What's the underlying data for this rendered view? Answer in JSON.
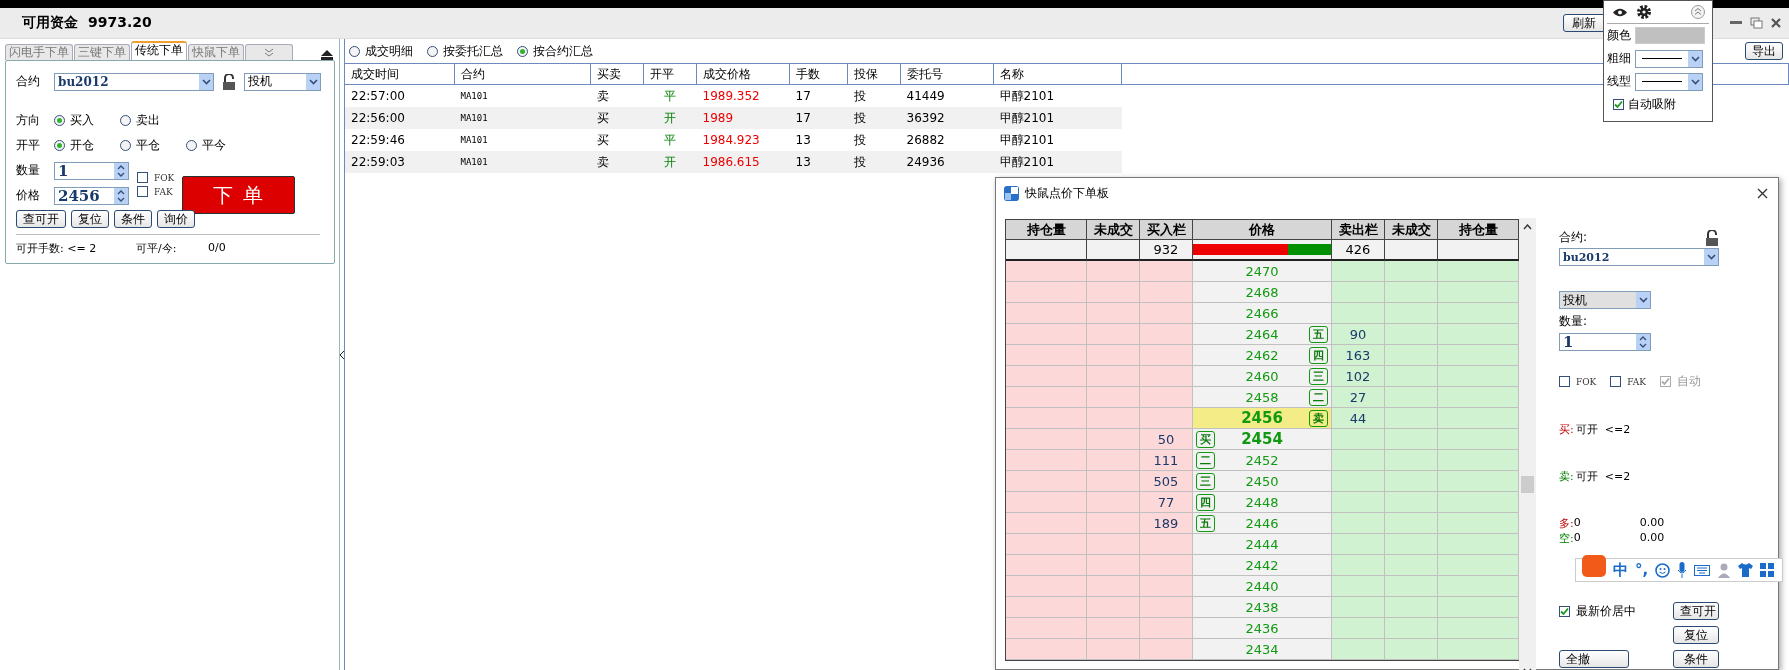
{
  "header": {
    "funds_label": "可用资金",
    "funds_value": "9973.20",
    "refresh_button": "刷新"
  },
  "order_panel": {
    "tabs": [
      {
        "label": "闪电手下单",
        "selected": false
      },
      {
        "label": "三键下单",
        "selected": false
      },
      {
        "label": "传统下单",
        "selected": true
      },
      {
        "label": "快鼠下单",
        "selected": false
      }
    ],
    "contract_label": "合约",
    "contract": "bu2012",
    "hedge": "投机",
    "direction_label": "方向",
    "direction_options": [
      {
        "label": "买入",
        "selected": true
      },
      {
        "label": "卖出",
        "selected": false
      }
    ],
    "offset_label": "开平",
    "offset_options": [
      {
        "label": "开仓",
        "selected": true
      },
      {
        "label": "平仓",
        "selected": false
      },
      {
        "label": "平今",
        "selected": false
      }
    ],
    "qty_label": "数量",
    "qty": "1",
    "price_label": "价格",
    "price": "2456",
    "flags": [
      {
        "label": "FOK",
        "checked": false
      },
      {
        "label": "FAK",
        "checked": false
      }
    ],
    "submit_button": "下 单",
    "buttons": [
      "查可开",
      "复位",
      "条件",
      "询价"
    ],
    "footer": {
      "open_label": "可开手数: <= 2",
      "close_label": "可平/今:",
      "close_value": "0/0"
    }
  },
  "trades": {
    "views": [
      {
        "label": "成交明细",
        "selected": false
      },
      {
        "label": "按委托汇总",
        "selected": false
      },
      {
        "label": "按合约汇总",
        "selected": true
      }
    ],
    "export_button": "导出",
    "columns": [
      "成交时间",
      "合约",
      "买卖",
      "开平",
      "成交价格",
      "手数",
      "投保",
      "委托号",
      "名称"
    ],
    "rows": [
      {
        "time": "22:57:00",
        "contract": "MA101",
        "side": "卖",
        "offset": "平",
        "price": "1989.352",
        "qty": "17",
        "hedge": "投",
        "order_no": "41449",
        "name": "甲醇2101"
      },
      {
        "time": "22:56:00",
        "contract": "MA101",
        "side": "买",
        "offset": "开",
        "price": "1989",
        "qty": "17",
        "hedge": "投",
        "order_no": "36392",
        "name": "甲醇2101"
      },
      {
        "time": "22:59:46",
        "contract": "MA101",
        "side": "买",
        "offset": "平",
        "price": "1984.923",
        "qty": "13",
        "hedge": "投",
        "order_no": "26882",
        "name": "甲醇2101"
      },
      {
        "time": "22:59:03",
        "contract": "MA101",
        "side": "卖",
        "offset": "开",
        "price": "1986.615",
        "qty": "13",
        "hedge": "投",
        "order_no": "24936",
        "name": "甲醇2101"
      }
    ]
  },
  "chart_tool": {
    "color_label": "颜色",
    "width_label": "粗细",
    "style_label": "线型",
    "snap": {
      "label": "自动吸附",
      "checked": true
    }
  },
  "ladder_window": {
    "title": "快鼠点价下单板",
    "columns": [
      "持仓量",
      "未成交",
      "买入栏",
      "价格",
      "卖出栏",
      "未成交",
      "持仓量"
    ],
    "totals": {
      "buy": "932",
      "sell": "426",
      "level": 0.686
    },
    "rows": [
      {
        "price": "2470",
        "kind": "plain"
      },
      {
        "price": "2468",
        "kind": "plain"
      },
      {
        "price": "2466",
        "kind": "plain"
      },
      {
        "price": "2464",
        "kind": "ask",
        "tag": "五",
        "qty": "90"
      },
      {
        "price": "2462",
        "kind": "ask",
        "tag": "四",
        "qty": "163"
      },
      {
        "price": "2460",
        "kind": "ask",
        "tag": "三",
        "qty": "102"
      },
      {
        "price": "2458",
        "kind": "ask",
        "tag": "二",
        "qty": "27"
      },
      {
        "price": "2456",
        "kind": "ask_best",
        "tag": "卖",
        "qty": "44"
      },
      {
        "price": "2454",
        "kind": "bid_best",
        "tag": "买",
        "qty": "50"
      },
      {
        "price": "2452",
        "kind": "bid",
        "tag": "二",
        "qty": "111"
      },
      {
        "price": "2450",
        "kind": "bid",
        "tag": "三",
        "qty": "505"
      },
      {
        "price": "2448",
        "kind": "bid",
        "tag": "四",
        "qty": "77"
      },
      {
        "price": "2446",
        "kind": "bid",
        "tag": "五",
        "qty": "189"
      },
      {
        "price": "2444",
        "kind": "plain"
      },
      {
        "price": "2442",
        "kind": "plain"
      },
      {
        "price": "2440",
        "kind": "plain"
      },
      {
        "price": "2438",
        "kind": "plain"
      },
      {
        "price": "2436",
        "kind": "plain"
      },
      {
        "price": "2434",
        "kind": "plain"
      }
    ],
    "side_panel": {
      "contract_label": "合约:",
      "contract": "bu2012",
      "hedge": "投机",
      "qty_label": "数量:",
      "qty": "1",
      "flags": [
        {
          "label": "FOK",
          "checked": false,
          "disabled": false
        },
        {
          "label": "FAK",
          "checked": false,
          "disabled": false
        },
        {
          "label": "自动",
          "checked": true,
          "disabled": true
        }
      ],
      "open_lines": [
        {
          "kind": "buy",
          "side": "买:",
          "text": "可开  <=2"
        },
        {
          "kind": "sell",
          "side": "卖:",
          "text": "可开  <=2"
        }
      ],
      "positions": [
        {
          "kind": "buy",
          "side": "多:",
          "qty": "0",
          "amount": "0.00"
        },
        {
          "kind": "sell",
          "side": "空:",
          "qty": "0",
          "amount": "0.00"
        }
      ],
      "center": {
        "label": "最新价居中",
        "checked": true
      },
      "query_button": "查可开",
      "reset_button": "复位",
      "cancel_all_button": "全撤",
      "condition_button": "条件"
    }
  },
  "ime_bar": {
    "mode": "中",
    "punct": "°,"
  }
}
